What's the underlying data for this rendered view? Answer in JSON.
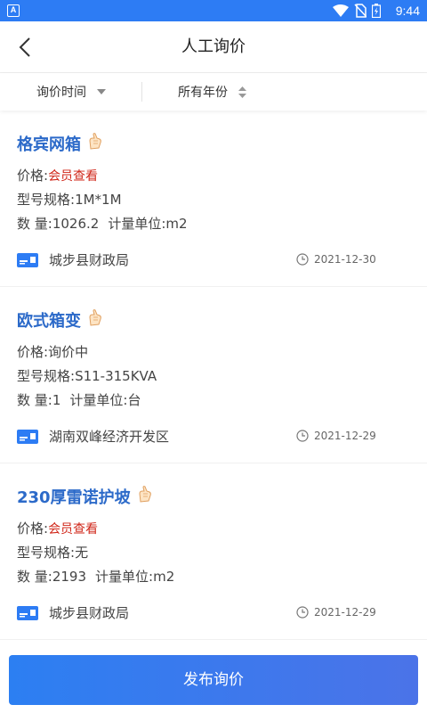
{
  "status_bar": {
    "time": "9:44",
    "app_indicator": "A"
  },
  "header": {
    "title": "人工询价",
    "back_icon": "chevron-left-icon"
  },
  "filters": {
    "time_label": "询价时间",
    "year_label": "所有年份"
  },
  "items": [
    {
      "name": "格宾网箱",
      "price_label": "价格:",
      "price_value": "会员查看",
      "spec_label": "型号规格:",
      "spec_value": "1M*1M",
      "qty_label": "数 量:",
      "qty_value": "1026.2",
      "unit_label": "计量单位:",
      "unit_value": "m2",
      "org": "城步县财政局",
      "date": "2021-12-30"
    },
    {
      "name": "欧式箱变",
      "price_label": "价格:",
      "price_value": "询价中",
      "spec_label": "型号规格:",
      "spec_value": "S11-315KVA",
      "qty_label": "数 量:",
      "qty_value": "1",
      "unit_label": "计量单位:",
      "unit_value": "台",
      "org": "湖南双峰经济开发区",
      "date": "2021-12-29"
    },
    {
      "name": "230厚雷诺护坡",
      "price_label": "价格:",
      "price_value": "会员查看",
      "spec_label": "型号规格:",
      "spec_value": "无",
      "qty_label": "数 量:",
      "qty_value": "2193",
      "unit_label": "计量单位:",
      "unit_value": "m2",
      "org": "城步县财政局",
      "date": "2021-12-29"
    }
  ],
  "publish_button": "发布询价",
  "colors": {
    "accent": "#2d7cf4",
    "title_blue": "#2c6ac9",
    "member_red": "#d0271a"
  }
}
